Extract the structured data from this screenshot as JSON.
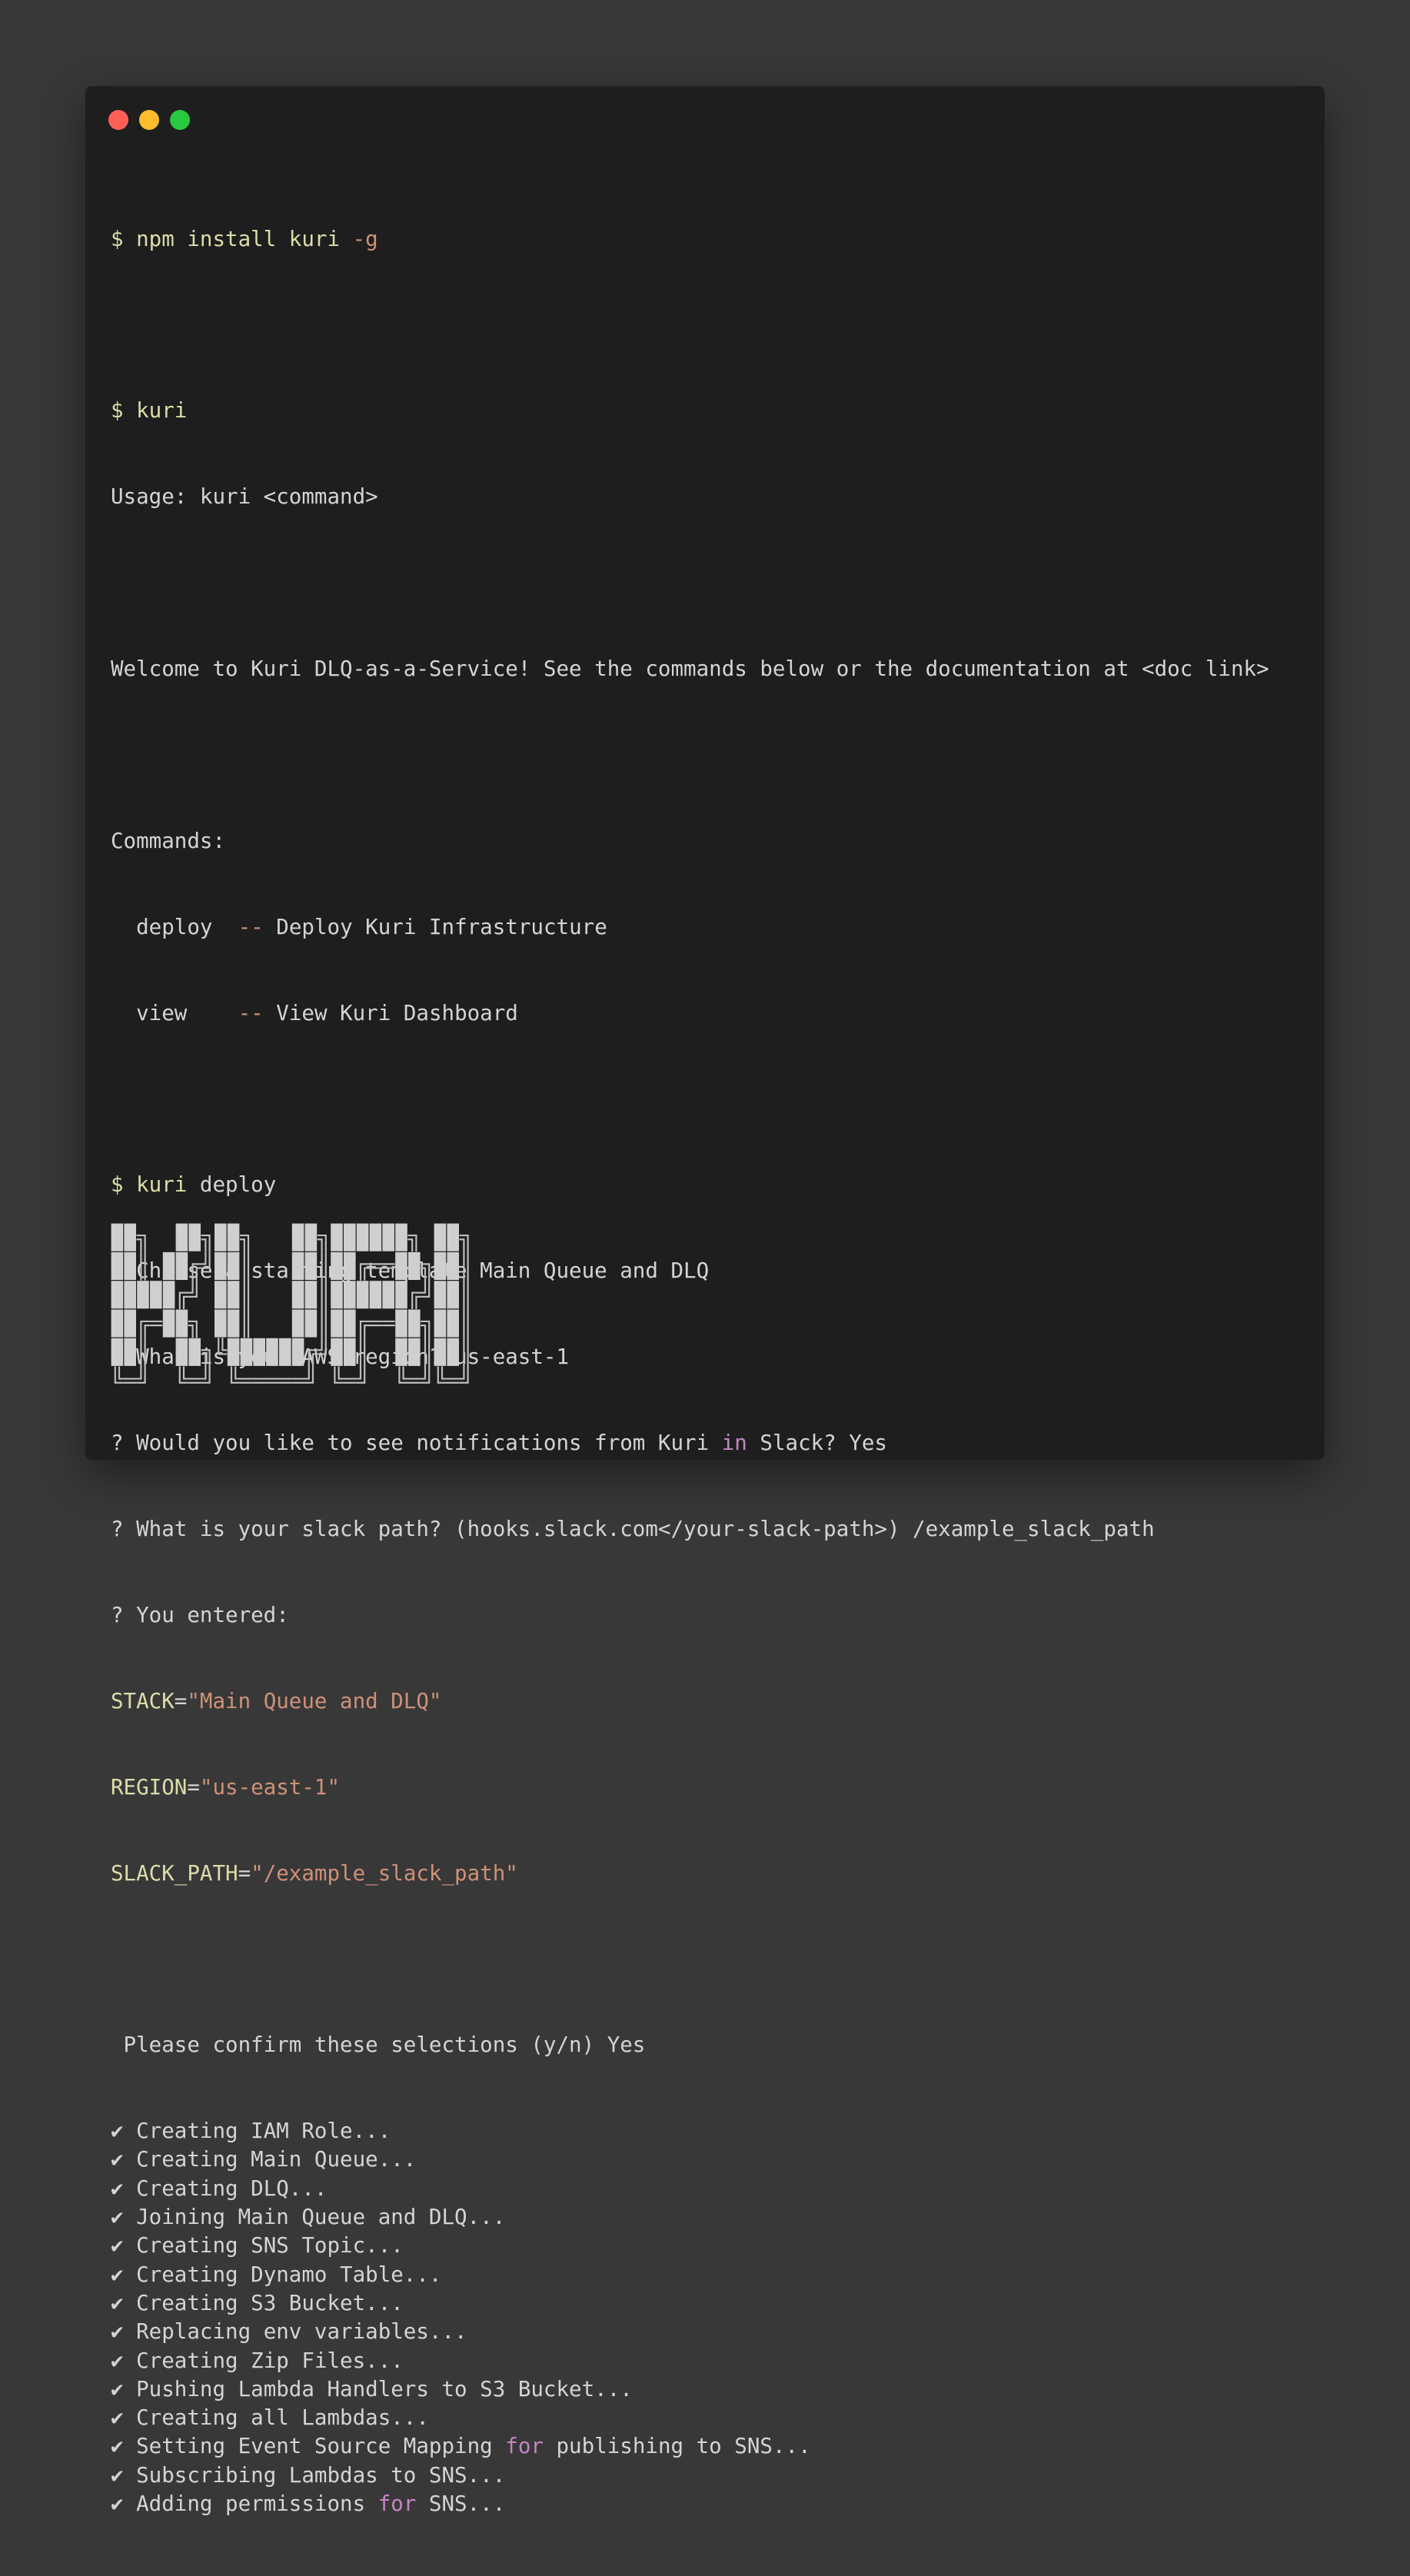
{
  "window": {
    "controls": [
      {
        "name": "close",
        "color": "#ff5f57"
      },
      {
        "name": "minimize",
        "color": "#febc2e"
      },
      {
        "name": "maximize",
        "color": "#28c840"
      }
    ]
  },
  "colors": {
    "background": "#383838",
    "terminal_bg": "#1e1e1e",
    "text": "#d4d4d4",
    "prompt": "#dcdcaa",
    "string": "#ce9178",
    "keyword": "#c586c0"
  },
  "install": {
    "prompt": "$",
    "command": "npm install kuri",
    "flag": "-g"
  },
  "usage": {
    "prompt": "$",
    "command": "kuri",
    "usage_line": "Usage: kuri <command>"
  },
  "welcome": "Welcome to Kuri DLQ-as-a-Service! See the commands below or the documentation at <doc link>",
  "commands": {
    "header": "Commands:",
    "items": [
      {
        "name": "deploy",
        "sep": "--",
        "desc": "Deploy Kuri Infrastructure",
        "pad": "  "
      },
      {
        "name": "view",
        "sep": "--",
        "desc": "View Kuri Dashboard",
        "pad": "    "
      }
    ]
  },
  "deploy": {
    "prompt": "$",
    "command": "kuri",
    "arg": "deploy",
    "q1": "? Choose a starting template Main Queue and DLQ",
    "q2": "? What is your AWS region? us-east-1",
    "q3_before": "? Would you like to see notifications from Kuri ",
    "q3_kw": "in",
    "q3_after": " Slack? Yes",
    "q4": "? What is your slack path? (hooks.slack.com</your-slack-path>) /example_slack_path",
    "q5": "? You entered:",
    "env": [
      {
        "key": "STACK",
        "value": "\"Main Queue and DLQ\""
      },
      {
        "key": "REGION",
        "value": "\"us-east-1\""
      },
      {
        "key": "SLACK_PATH",
        "value": "\"/example_slack_path\""
      }
    ],
    "confirm": " Please confirm these selections (y/n) Yes"
  },
  "check_mark": "✔",
  "steps": [
    {
      "before": "Creating IAM Role...",
      "kw": "",
      "after": ""
    },
    {
      "before": "Creating Main Queue...",
      "kw": "",
      "after": ""
    },
    {
      "before": "Creating DLQ...",
      "kw": "",
      "after": ""
    },
    {
      "before": "Joining Main Queue and DLQ...",
      "kw": "",
      "after": ""
    },
    {
      "before": "Creating SNS Topic...",
      "kw": "",
      "after": ""
    },
    {
      "before": "Creating Dynamo Table...",
      "kw": "",
      "after": ""
    },
    {
      "before": "Creating S3 Bucket...",
      "kw": "",
      "after": ""
    },
    {
      "before": "Replacing env variables...",
      "kw": "",
      "after": ""
    },
    {
      "before": "Creating Zip Files...",
      "kw": "",
      "after": ""
    },
    {
      "before": "Pushing Lambda Handlers to S3 Bucket...",
      "kw": "",
      "after": ""
    },
    {
      "before": "Creating all Lambdas...",
      "kw": "",
      "after": ""
    },
    {
      "before": "Setting Event Source Mapping ",
      "kw": "for",
      "after": " publishing to SNS..."
    },
    {
      "before": "Subscribing Lambdas to SNS...",
      "kw": "",
      "after": ""
    },
    {
      "before": "Adding permissions ",
      "kw": "for",
      "after": " SNS..."
    }
  ],
  "logo": {
    "text": "KURI"
  }
}
